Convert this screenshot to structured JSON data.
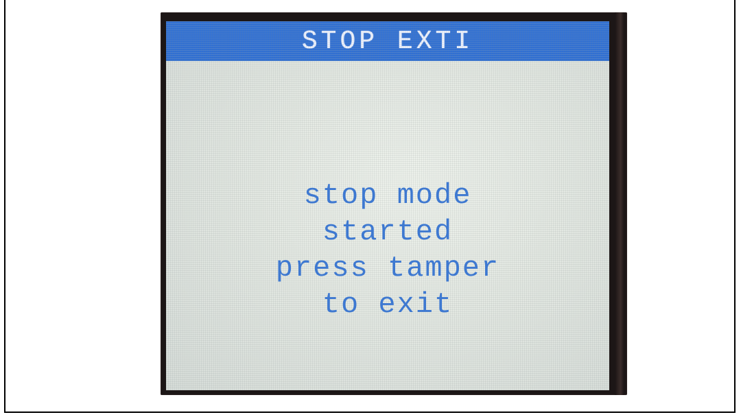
{
  "screen": {
    "title": "STOP EXTI",
    "message_lines": [
      "stop mode",
      "started",
      "press tamper",
      "to exit"
    ]
  },
  "colors": {
    "title_bar": "#2f6fd3",
    "title_text": "#eef3ff",
    "message_text": "#3a78d6",
    "screen_background": "#e3e8e2",
    "device_bezel": "#1c1616"
  }
}
